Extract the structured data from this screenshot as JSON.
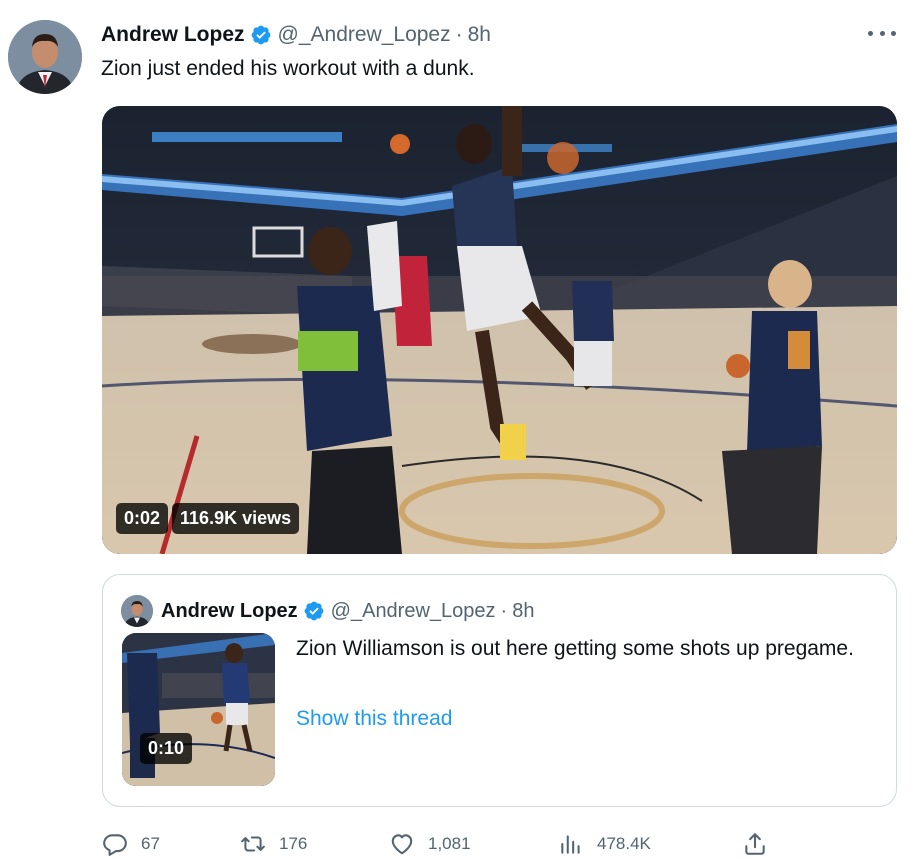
{
  "tweet": {
    "author_name": "Andrew Lopez",
    "handle": "@_Andrew_Lopez",
    "separator": "·",
    "time": "8h",
    "text": "Zion just ended his workout with a dunk.",
    "video": {
      "duration": "0:02",
      "views": "116.9K views"
    }
  },
  "quoted_tweet": {
    "author_name": "Andrew Lopez",
    "handle": "@_Andrew_Lopez",
    "separator": "·",
    "time": "8h",
    "text": "Zion Williamson is out here getting some shots up pregame.",
    "link_text": "Show this thread",
    "video_duration": "0:10"
  },
  "actions": {
    "replies": "67",
    "retweets": "176",
    "likes": "1,081",
    "views": "478.4K"
  },
  "colors": {
    "verified": "#1d9bf0",
    "link": "#1d9bf0",
    "secondary_text": "#536471",
    "border": "#cfd9de"
  },
  "icons": [
    "verified-badge-icon",
    "more-options-icon",
    "reply-icon",
    "retweet-icon",
    "like-icon",
    "analytics-icon",
    "share-icon"
  ]
}
